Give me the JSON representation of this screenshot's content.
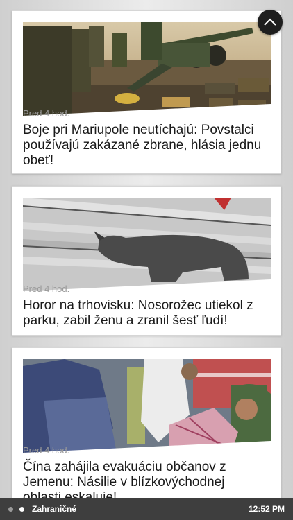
{
  "articles": [
    {
      "time": "Pred 4 hod.",
      "headline": "Boje pri Mariupole neutíchajú: Povstalci používajú zakázané zbrane, hlásia jednu obeť!",
      "image": "artillery-soldiers-photo"
    },
    {
      "time": "Pred 4 hod.",
      "headline": "Horor na trhovisku: Nosorožec utiekol z parku, zabil ženu a zranil šesť ľudí!",
      "image": "rhinoceros-market-photo"
    },
    {
      "time": "Pred 4 hod.",
      "headline": "Čína zahájila evakuáciu občanov z Jemenu: Násilie v blízkovýchodnej oblasti eskaluje!",
      "image": "evacuation-crowd-photo"
    }
  ],
  "scroll_top_icon": "chevron-up-icon",
  "bottom_bar": {
    "pager_icon": "page-dots-icon",
    "section": "Zahraničné",
    "clock": "12:52 PM"
  },
  "colors": {
    "card": "#ffffff",
    "headline": "#1a1a1a",
    "meta": "#9a9a9a",
    "bar": "#3e3e3e"
  }
}
